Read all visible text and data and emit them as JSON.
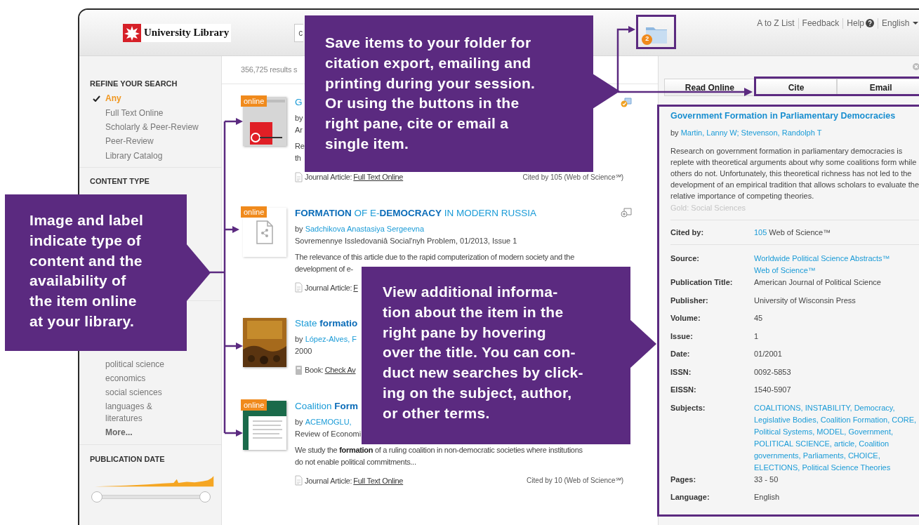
{
  "header": {
    "logo": "University Library",
    "search": {
      "value": "c"
    },
    "folder": {
      "badge": "2"
    },
    "links": [
      {
        "label": "A to Z List",
        "kind": "plain"
      },
      {
        "label": "Feedback",
        "kind": "plain"
      },
      {
        "label": "Help",
        "kind": "help"
      },
      {
        "label": "English",
        "kind": "menu"
      }
    ]
  },
  "sidebar": {
    "refine": {
      "heading": "REFINE YOUR SEARCH",
      "items": [
        {
          "label": "Any",
          "selected": true
        },
        {
          "label": "Full Text Online",
          "selected": false
        },
        {
          "label": "Scholarly & Peer-Review",
          "selected": false
        },
        {
          "label": "Peer-Review",
          "selected": false
        },
        {
          "label": "Library Catalog",
          "selected": false
        }
      ]
    },
    "content_type": {
      "heading": "CONTENT TYPE"
    },
    "subjects": {
      "items": [
        "political science",
        "economics",
        "social sciences",
        "languages & literatures"
      ],
      "more": "More..."
    },
    "publication_date": {
      "heading": "PUBLICATION DATE"
    }
  },
  "results": {
    "count": "356,725 results s",
    "items": [
      {
        "kind": "article",
        "thumbnail": {
          "kind": "picture"
        },
        "badge": "online",
        "saved": true,
        "title": "G",
        "byline": "by",
        "source": "Ar",
        "abstract": [
          "Re",
          "th"
        ],
        "format": "Journal Article:",
        "link": "Full Text Online",
        "cited": "Cited by 105 (Web of Science℠)"
      },
      {
        "kind": "article",
        "thumbnail": {
          "kind": "document"
        },
        "badge": "online",
        "saved": false,
        "title": "**FORMATION** OF E-**DEMOCRACY** IN MODERN RUSSIA",
        "byline": "by",
        "authors": "Sadchikova Anastasiya Sergeevna",
        "source": "Sovremennye Issledovaniâ Social'nyh Problem, 01/2013, Issue 1",
        "abstract": [
          "The relevance of this article due to the rapid computerization of modern society and the",
          "development of e-"
        ],
        "format": "Journal Article:",
        "link": "F"
      },
      {
        "kind": "book",
        "thumbnail": {
          "kind": "picture"
        },
        "title": "State **formatio**",
        "byline": "by",
        "authors": "López-Alves, F",
        "source": "2000",
        "format": "Book:",
        "link": "Check Av"
      },
      {
        "kind": "article",
        "thumbnail": {
          "kind": "picture"
        },
        "badge": "online",
        "title": "Coalition **Form**",
        "byline": "by",
        "authors": "ACEMOGLU,",
        "source": "Review of Economi",
        "abstract": [
          "We study the **formation** of a ruling coalition in non-democratic societies where institutions",
          "do not enable political commitments..."
        ],
        "format": "Journal Article:",
        "link": "Full Text Online",
        "cited": "Cited by 10 (Web of Science℠)"
      }
    ]
  },
  "right_pane": {
    "tabs": [
      {
        "label": "Read Online"
      },
      {
        "label": "Cite"
      },
      {
        "label": "Email"
      }
    ],
    "detail": {
      "title": "Government Formation in Parliamentary Democracies",
      "byline": "by",
      "authors": "Martin, Lanny W; Stevenson, Randolph T",
      "abstract": "Research on government formation in parliamentary democracies is replete with theoretical arguments about why some coalitions form while others do not. Unfortunately, this theoretical richness has not led to the development of an empirical tradition that allows scholars to evaluate the relative importance of competing theories.",
      "discipline": "Gold: Social Sciences",
      "cited_by": {
        "label": "Cited by:",
        "count": "105",
        "source": "Web of Science™"
      },
      "fields": [
        {
          "label": "Source:",
          "kind": "link",
          "values": [
            "Worldwide Political Science Abstracts™",
            "Web of Science™"
          ]
        },
        {
          "label": "Publication Title:",
          "kind": "text",
          "values": [
            "American Journal of Political Science"
          ]
        },
        {
          "label": "Publisher:",
          "kind": "text",
          "values": [
            "University of Wisconsin Press"
          ]
        },
        {
          "label": "Volume:",
          "kind": "text",
          "values": [
            "45"
          ]
        },
        {
          "label": "Issue:",
          "kind": "text",
          "values": [
            "1"
          ]
        },
        {
          "label": "Date:",
          "kind": "text",
          "values": [
            "01/2001"
          ]
        },
        {
          "label": "ISSN:",
          "kind": "text",
          "values": [
            "0092-5853"
          ]
        },
        {
          "label": "EISSN:",
          "kind": "text",
          "values": [
            "1540-5907"
          ]
        },
        {
          "label": "Subjects:",
          "kind": "link",
          "values": [
            "COALITIONS, INSTABILITY, Democracy, Legislative Bodies, Coalition Formation, CORE, Political Systems, MODEL, Government, POLITICAL SCIENCE, article, Coalition governments, Parliaments, CHOICE, ELECTIONS, Political Science Theories"
          ]
        },
        {
          "label": "Pages:",
          "kind": "text",
          "values": [
            "33 - 50"
          ]
        },
        {
          "label": "Language:",
          "kind": "text",
          "values": [
            "English"
          ]
        }
      ]
    }
  },
  "callouts": [
    {
      "text": "Save items to your folder for\ncitation export, emailing and\nprinting during your session.\nOr using the buttons in the\nright pane, cite or email a\nsingle item."
    },
    {
      "text": "Image and label\nindicate type of\ncontent and the\navailability of\nthe item online\nat your library."
    },
    {
      "text": "View additional informa-\ntion about the item in the\nright pane by hovering\nover the title. You can con-\nduct new searches by click-\ning on the subject, author,\nor other terms."
    }
  ]
}
